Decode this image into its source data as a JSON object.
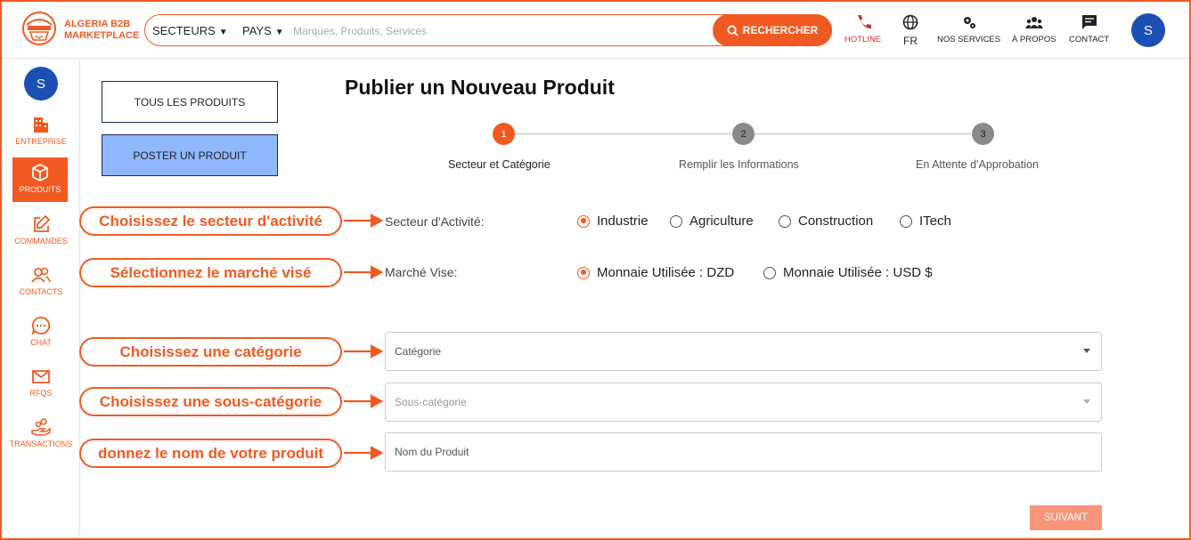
{
  "colors": {
    "accent": "#f05a22",
    "blue_button": "#8fb8ff",
    "avatar": "#1b4fb3"
  },
  "header": {
    "brand_line1": "ALGERIA B2B",
    "brand_line2": "MARKETPLACE",
    "sectors_label": "SECTEURS",
    "country_label": "PAYS",
    "search_placeholder": "Marques, Produits, Services",
    "search_button": "RECHERCHER",
    "nav": {
      "hotline": "HOTLINE",
      "language": "FR",
      "services": "NOS SERVICES",
      "about": "À PROPOS",
      "contact": "CONTACT"
    },
    "avatar_initial": "S"
  },
  "sidebar": {
    "avatar_initial": "S",
    "items": [
      {
        "label": "ENTREPRISE",
        "icon": "building-icon"
      },
      {
        "label": "PRODUITS",
        "icon": "box-icon",
        "active": true
      },
      {
        "label": "COMMANDES",
        "icon": "edit-icon"
      },
      {
        "label": "CONTACTS",
        "icon": "users-icon"
      },
      {
        "label": "CHAT",
        "icon": "chat-icon"
      },
      {
        "label": "RFQS",
        "icon": "mail-icon"
      },
      {
        "label": "TRANSACTIONS",
        "icon": "hand-coins-icon"
      }
    ]
  },
  "buttons": {
    "all_products": "TOUS LES PRODUITS",
    "post_product": "POSTER UN PRODUIT"
  },
  "page_title": "Publier un Nouveau Produit",
  "stepper": [
    {
      "number": "1",
      "label": "Secteur et Catégorie",
      "active": true
    },
    {
      "number": "2",
      "label": "Remplir les Informations"
    },
    {
      "number": "3",
      "label": "En Attente d'Approbation"
    }
  ],
  "annotations": {
    "sector": "Choisissez le secteur d'activité",
    "market": "Sélectionnez le marché visé",
    "category": "Choisissez une catégorie",
    "subcategory": "Choisissez une sous-catégorie",
    "name": "donnez le nom de votre produit"
  },
  "form": {
    "sector_label": "Secteur d'Activité:",
    "sector_options": [
      "Industrie",
      "Agriculture",
      "Construction",
      "ITech"
    ],
    "sector_selected": "Industrie",
    "market_label": "Marché Vise:",
    "market_options": [
      "Monnaie Utilisée : DZD",
      "Monnaie Utilisée : USD $"
    ],
    "market_selected": "Monnaie Utilisée : DZD",
    "category_placeholder": "Catégorie",
    "subcategory_placeholder": "Sous-catégorie",
    "name_placeholder": "Nom du Produit",
    "next_button": "SUIVANT"
  }
}
